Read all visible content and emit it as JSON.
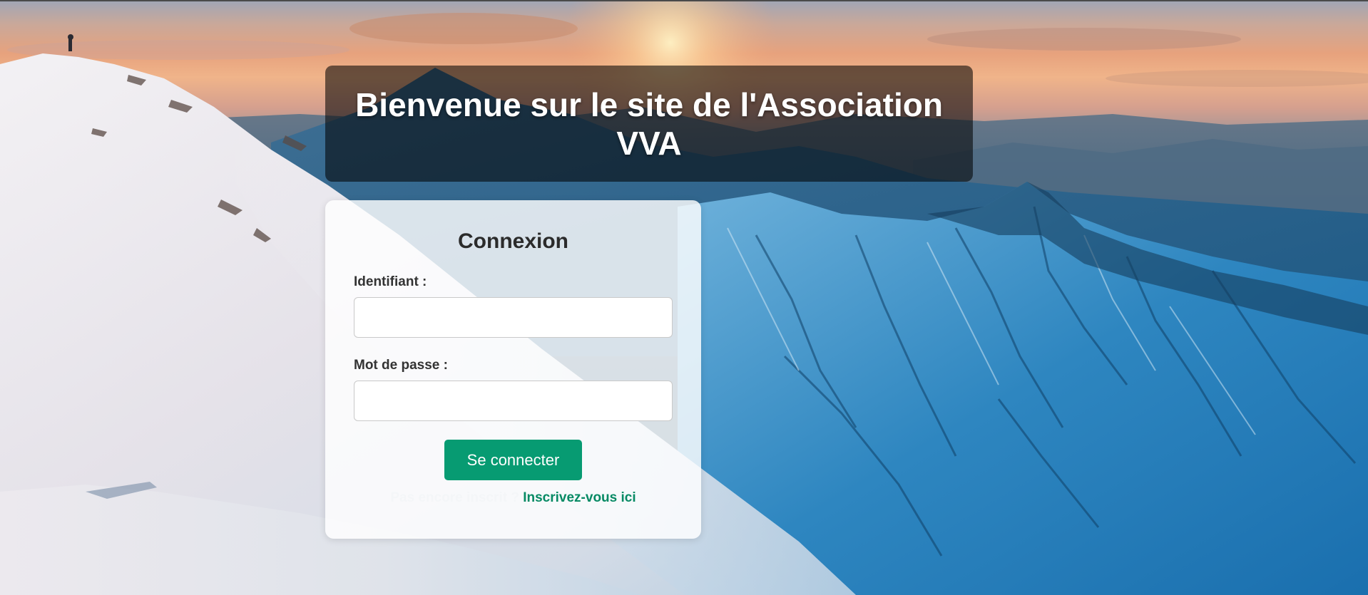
{
  "banner": {
    "title": "Bienvenue sur le site de l'Association VVA"
  },
  "login": {
    "heading": "Connexion",
    "username_label": "Identifiant :",
    "username_value": "",
    "password_label": "Mot de passe :",
    "password_value": "",
    "submit_label": "Se connecter",
    "signup_prompt": "Pas encore inscrit ?",
    "signup_link": "Inscrivez-vous ici"
  },
  "colors": {
    "button_bg": "#079b72",
    "link": "#078a64",
    "banner_bg": "rgba(0,0,0,0.56)",
    "card_bg": "rgba(255,255,255,0.82)"
  },
  "background": {
    "icon": "mountain-landscape-photo"
  }
}
